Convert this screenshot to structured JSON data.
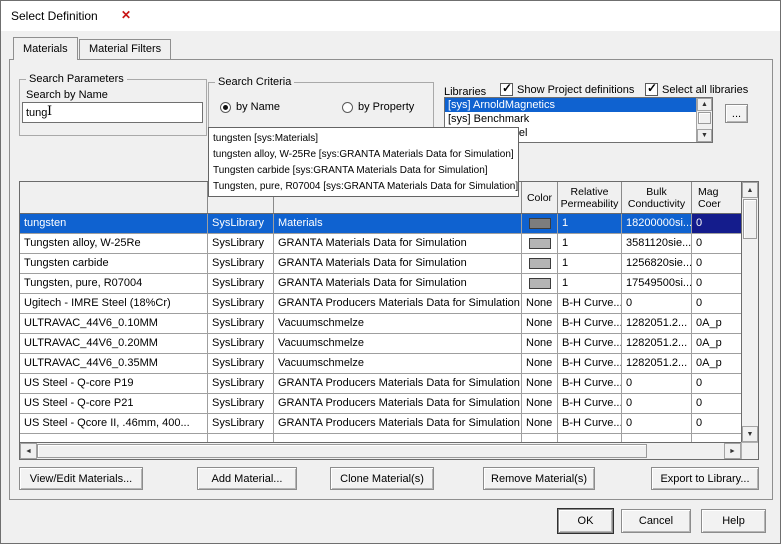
{
  "dialog": {
    "title": "Select Definition"
  },
  "icons": {
    "dialog_marker": "✕",
    "check": "✓",
    "scroll_up": "▲",
    "scroll_down": "▼",
    "scroll_left": "◄",
    "scroll_right": "►",
    "text_cursor": "I"
  },
  "tabs": [
    {
      "label": "Materials",
      "active": true
    },
    {
      "label": "Material Filters",
      "active": false
    }
  ],
  "search_parameters": {
    "group_label": "Search Parameters",
    "field_label": "Search by Name",
    "value": "tung"
  },
  "search_criteria": {
    "group_label": "Search Criteria",
    "options": [
      {
        "label": "by Name",
        "selected": true
      },
      {
        "label": "by Property",
        "selected": false
      }
    ]
  },
  "libraries": {
    "label": "Libraries",
    "show_project_definitions": {
      "label": "Show Project definitions",
      "checked": true
    },
    "select_all_libraries": {
      "label": "Select all libraries",
      "checked": true
    },
    "items": [
      {
        "text": "[sys] ArnoldMagnetics",
        "selected": true
      },
      {
        "text": "[sys] Benchmark",
        "selected": false
      },
      {
        "text": "[sys] ChinaSteel",
        "selected": false
      }
    ],
    "browse_label": "..."
  },
  "suggestions": [
    "tungsten [sys:Materials]",
    "tungsten alloy, W-25Re [sys:GRANTA Materials Data for Simulation]",
    "Tungsten carbide [sys:GRANTA Materials Data for Simulation]",
    "Tungsten, pure, R07004 [sys:GRANTA Materials Data for Simulation]"
  ],
  "table": {
    "headers": [
      "",
      "",
      "",
      "Color",
      "Relative Permeability",
      "Bulk Conductivity",
      "Mag Coer"
    ],
    "rows": [
      {
        "name": "tungsten",
        "location": "SysLibrary",
        "origin": "Materials",
        "color": "",
        "relative_permeability": "1",
        "bulk_conductivity": "18200000si...",
        "mag_coer": "0",
        "selected": true
      },
      {
        "name": "Tungsten alloy, W-25Re",
        "location": "SysLibrary",
        "origin": "GRANTA Materials Data for Simulation",
        "color": "",
        "relative_permeability": "1",
        "bulk_conductivity": "3581120sie...",
        "mag_coer": "0",
        "selected": false
      },
      {
        "name": "Tungsten carbide",
        "location": "SysLibrary",
        "origin": "GRANTA Materials Data for Simulation",
        "color": "",
        "relative_permeability": "1",
        "bulk_conductivity": "1256820sie...",
        "mag_coer": "0",
        "selected": false
      },
      {
        "name": "Tungsten, pure, R07004",
        "location": "SysLibrary",
        "origin": "GRANTA Materials Data for Simulation",
        "color": "",
        "relative_permeability": "1",
        "bulk_conductivity": "17549500si...",
        "mag_coer": "0",
        "selected": false
      },
      {
        "name": "Ugitech - IMRE Steel (18%Cr)",
        "location": "SysLibrary",
        "origin": "GRANTA Producers Materials Data for Simulation",
        "color": "None",
        "relative_permeability": "B-H Curve...",
        "bulk_conductivity": "0",
        "mag_coer": "0",
        "selected": false
      },
      {
        "name": "ULTRAVAC_44V6_0.10MM",
        "location": "SysLibrary",
        "origin": "Vacuumschmelze",
        "color": "None",
        "relative_permeability": "B-H Curve...",
        "bulk_conductivity": "1282051.2...",
        "mag_coer": "0A_p",
        "selected": false
      },
      {
        "name": "ULTRAVAC_44V6_0.20MM",
        "location": "SysLibrary",
        "origin": "Vacuumschmelze",
        "color": "None",
        "relative_permeability": "B-H Curve...",
        "bulk_conductivity": "1282051.2...",
        "mag_coer": "0A_p",
        "selected": false
      },
      {
        "name": "ULTRAVAC_44V6_0.35MM",
        "location": "SysLibrary",
        "origin": "Vacuumschmelze",
        "color": "None",
        "relative_permeability": "B-H Curve...",
        "bulk_conductivity": "1282051.2...",
        "mag_coer": "0A_p",
        "selected": false
      },
      {
        "name": "US Steel - Q-core P19",
        "location": "SysLibrary",
        "origin": "GRANTA Producers Materials Data for Simulation",
        "color": "None",
        "relative_permeability": "B-H Curve...",
        "bulk_conductivity": "0",
        "mag_coer": "0",
        "selected": false
      },
      {
        "name": "US Steel - Q-core P21",
        "location": "SysLibrary",
        "origin": "GRANTA Producers Materials Data for Simulation",
        "color": "None",
        "relative_permeability": "B-H Curve...",
        "bulk_conductivity": "0",
        "mag_coer": "0",
        "selected": false
      },
      {
        "name": "US Steel - Qcore II, .46mm, 400...",
        "location": "SysLibrary",
        "origin": "GRANTA Producers Materials Data for Simulation",
        "color": "None",
        "relative_permeability": "B-H Curve...",
        "bulk_conductivity": "0",
        "mag_coer": "0",
        "selected": false
      },
      {
        "name": "",
        "location": "",
        "origin": "",
        "color": "",
        "relative_permeability": "",
        "bulk_conductivity": "",
        "mag_coer": "",
        "selected": false
      }
    ]
  },
  "actions": [
    {
      "label": "View/Edit Materials..."
    },
    {
      "label": "Add Material..."
    },
    {
      "label": "Clone Material(s)"
    },
    {
      "label": "Remove Material(s)"
    },
    {
      "label": "Export to Library..."
    }
  ],
  "footer": [
    {
      "label": "OK"
    },
    {
      "label": "Cancel"
    },
    {
      "label": "Help"
    }
  ],
  "colors": {
    "dialog_bg": "#f0f0f0",
    "titlebar_bg": "#ffffff",
    "selection_blue": "#0f62d0",
    "focused_cell_blue": "#141c8c",
    "swatch_tungsten_gray": "#7d7d7d",
    "swatch_light_gray": "#b4b4b4",
    "dialog_marker_red": "#c81414"
  }
}
